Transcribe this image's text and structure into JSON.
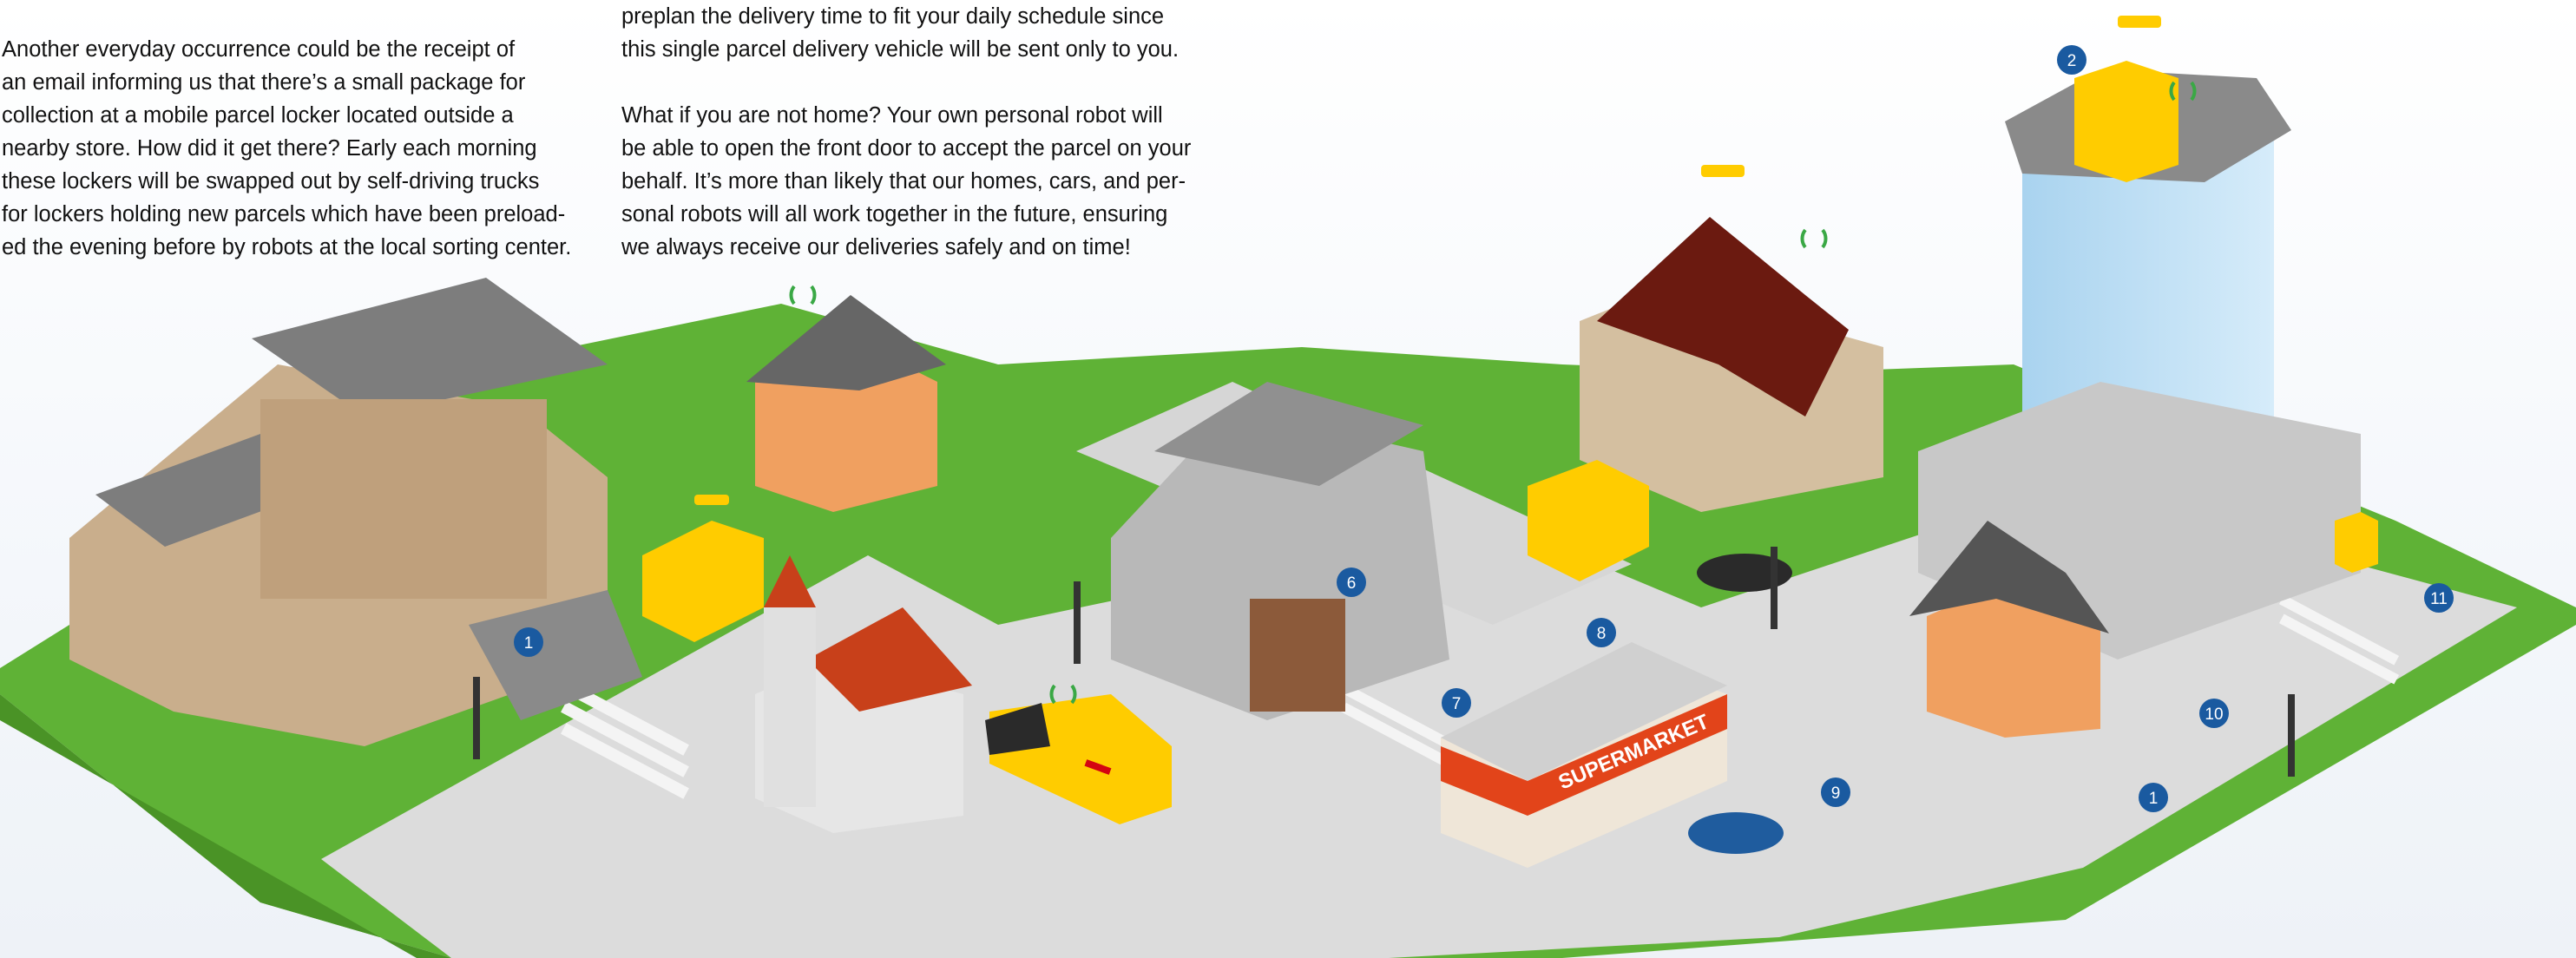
{
  "article": {
    "col1_p1": "Another everyday occurrence could be the receipt of\nan email informing us that there’s a small package for\ncollection at a mobile parcel locker located outside a\nnearby store. How did it get there? Early each morning\nthese lockers will be swapped out by self-driving trucks\nfor lockers holding new parcels which have been preload-\ned the evening before by robots at the local sorting center.",
    "col2_p1": "preplan the delivery time to fit your daily schedule since\nthis single parcel delivery vehicle will be sent only to you.",
    "col2_p2": "What if you are not home? Your own personal robot will\nbe able to open the front door to accept the parcel on your\nbehalf. It’s more than likely that our homes, cars, and per-\nsonal robots will all work together in the future, ensuring\nwe always receive our deliveries safely and on time!"
  },
  "scene": {
    "supermarket_sign": "SUPERMARKET",
    "markers": [
      "1",
      "2",
      "6",
      "7",
      "8",
      "9",
      "10",
      "11",
      "1"
    ],
    "colors": {
      "grass": "#5fb236",
      "road": "#dcdcdc",
      "dhl_yellow": "#ffcc00",
      "dhl_red": "#d40511",
      "marker_blue": "#1a5aa0",
      "signal_green": "#3aa845"
    }
  }
}
